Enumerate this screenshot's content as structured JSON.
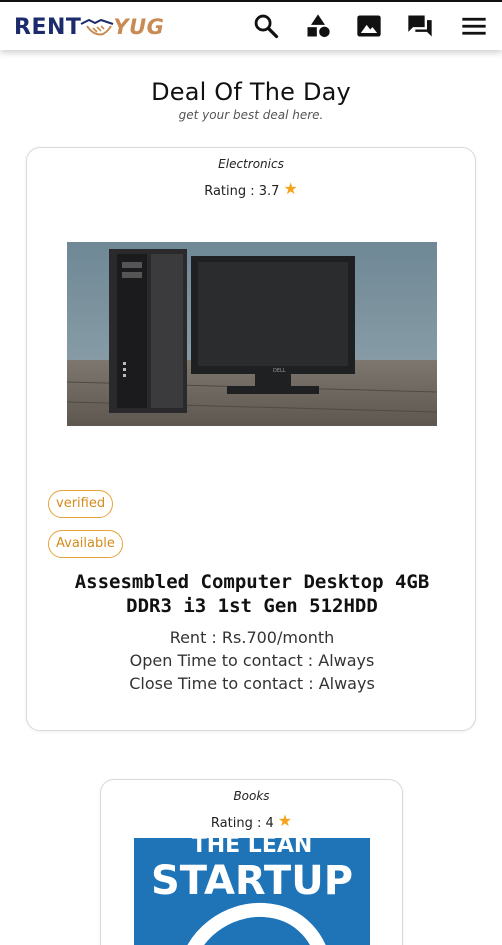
{
  "header": {
    "logo_left": "RENT",
    "logo_right": "YUG",
    "icons": [
      "search-icon",
      "category-shapes-icon",
      "image-icon",
      "forum-icon",
      "menu-icon"
    ]
  },
  "section": {
    "title": "Deal Of The Day",
    "subtitle": "get your best deal here."
  },
  "colors": {
    "brand_navy": "#1b2b6b",
    "brand_tan": "#c98a53",
    "badge_orange": "#e6a33a",
    "star": "#f5a31a"
  },
  "cards": [
    {
      "category": "Electronics",
      "rating_label": "Rating : 3.7",
      "star": "★",
      "badges": [
        "verified",
        "Available"
      ],
      "title": "Assesmbled Computer Desktop 4GB DDR3 i3 1st Gen 512HDD",
      "rent": "Rent : Rs.700/month",
      "open_time": "Open Time to contact : Always",
      "close_time": "Close Time to contact : Always"
    },
    {
      "category": "Books",
      "rating_label": "Rating : 4",
      "star": "★",
      "cover_text": "STARTUP",
      "cover_top_text": "THE LEAN"
    }
  ]
}
